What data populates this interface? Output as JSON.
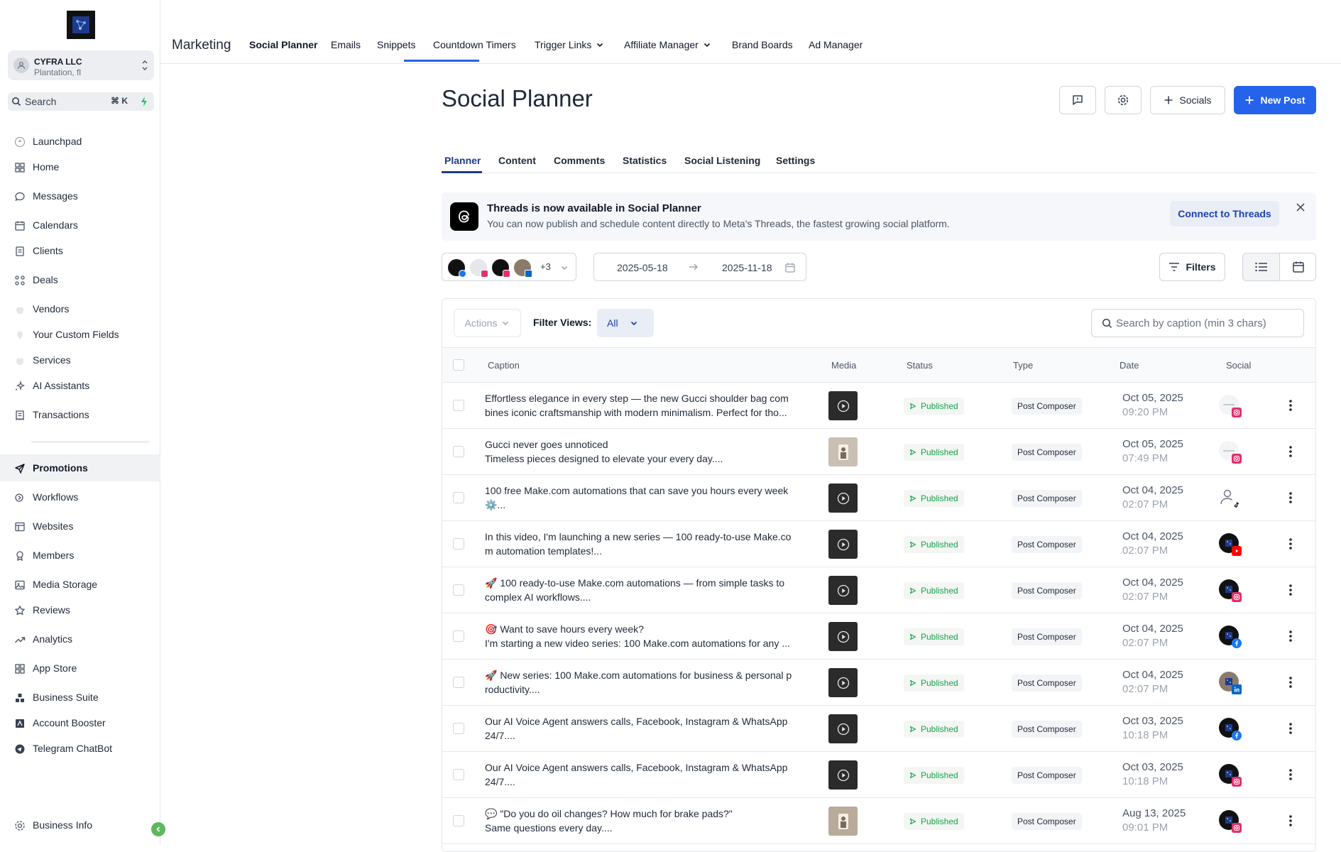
{
  "account": {
    "name": "CYFRA LLC",
    "location": "Plantation, fl"
  },
  "sidebar_search": {
    "label": "Search",
    "shortcut": "⌘ K"
  },
  "sidebar": {
    "items": [
      {
        "label": "Launchpad",
        "icon": "rocket-icon"
      },
      {
        "label": "Home",
        "icon": "grid-icon"
      },
      {
        "label": "Messages",
        "icon": "chat-icon"
      },
      {
        "label": "Calendars",
        "icon": "calendar-icon"
      },
      {
        "label": "Clients",
        "icon": "contacts-icon"
      },
      {
        "label": "Deals",
        "icon": "deals-icon"
      },
      {
        "label": "Vendors",
        "icon": "apple-icon"
      },
      {
        "label": "Your Custom Fields",
        "icon": "pin-icon"
      },
      {
        "label": "Services",
        "icon": "apple-icon"
      },
      {
        "label": "AI Assistants",
        "icon": "sparkle-icon"
      },
      {
        "label": "Transactions",
        "icon": "receipt-icon"
      }
    ],
    "items2": [
      {
        "label": "Promotions",
        "icon": "send-icon"
      },
      {
        "label": "Workflows",
        "icon": "workflow-icon"
      },
      {
        "label": "Websites",
        "icon": "website-icon"
      },
      {
        "label": "Members",
        "icon": "award-icon"
      },
      {
        "label": "Media Storage",
        "icon": "image-icon"
      },
      {
        "label": "Reviews",
        "icon": "star-icon"
      },
      {
        "label": "Analytics",
        "icon": "trend-icon"
      },
      {
        "label": "App Store",
        "icon": "apps-icon"
      },
      {
        "label": "Business Suite",
        "icon": "suite-icon"
      },
      {
        "label": "Account Booster",
        "icon": "booster-icon"
      },
      {
        "label": "Telegram ChatBot",
        "icon": "telegram-icon"
      }
    ],
    "footer": {
      "label": "Business Info",
      "icon": "settings-icon"
    }
  },
  "topbar": {
    "section": "Marketing",
    "nav": [
      "Social Planner",
      "Emails",
      "Snippets",
      "Countdown Timers",
      "Trigger Links",
      "Affiliate Manager",
      "Brand Boards",
      "Ad Manager"
    ]
  },
  "page": {
    "title": "Social Planner",
    "socials_button": "Socials",
    "new_post_button": "New Post",
    "tabs": [
      "Planner",
      "Content",
      "Comments",
      "Statistics",
      "Social Listening",
      "Settings"
    ]
  },
  "banner": {
    "title": "Threads is now available in Social Planner",
    "desc": "You can now publish and schedule content directly to Meta's Threads, the fastest growing social platform.",
    "cta": "Connect to Threads"
  },
  "toolbar": {
    "extra_accounts": "+3",
    "date_from": "2025-05-18",
    "date_to": "2025-11-18",
    "filters": "Filters"
  },
  "table": {
    "actions": "Actions",
    "filter_views_label": "Filter Views:",
    "filter_views_value": "All",
    "search_placeholder": "Search by caption (min 3 chars)",
    "columns": [
      "Caption",
      "Media",
      "Status",
      "Type",
      "Date",
      "Social"
    ],
    "rows": [
      {
        "line1": "Effortless elegance in every step — the new Gucci shoulder bag com",
        "line2": "bines iconic craftsmanship with modern minimalism. Perfect for tho...",
        "media": "video",
        "status": "Published",
        "type": "Post Composer",
        "date": "Oct 05, 2025",
        "time": "09:20 PM",
        "network": "instagram"
      },
      {
        "line1": "Gucci never goes unnoticed",
        "line2": "Timeless pieces designed to elevate your every day....",
        "media": "image",
        "status": "Published",
        "type": "Post Composer",
        "date": "Oct 05, 2025",
        "time": "07:49 PM",
        "network": "instagram"
      },
      {
        "line1": "100 free Make.com automations that can save you hours every week",
        "line2": "⚙️...",
        "media": "video",
        "status": "Published",
        "type": "Post Composer",
        "date": "Oct 04, 2025",
        "time": "02:07 PM",
        "network": "tiktok"
      },
      {
        "line1": "In this video, I'm launching a new series — 100 ready-to-use Make.co",
        "line2": "m automation templates!...",
        "media": "video",
        "status": "Published",
        "type": "Post Composer",
        "date": "Oct 04, 2025",
        "time": "02:07 PM",
        "network": "youtube"
      },
      {
        "line1": "🚀 100 ready-to-use Make.com automations — from simple tasks to",
        "line2": "complex AI workflows....",
        "media": "video",
        "status": "Published",
        "type": "Post Composer",
        "date": "Oct 04, 2025",
        "time": "02:07 PM",
        "network": "instagram"
      },
      {
        "line1": "🎯 Want to save hours every week?",
        "line2": "I'm starting a new video series: 100 Make.com automations for any ...",
        "media": "video",
        "status": "Published",
        "type": "Post Composer",
        "date": "Oct 04, 2025",
        "time": "02:07 PM",
        "network": "facebook"
      },
      {
        "line1": "🚀 New series: 100 Make.com automations for business & personal p",
        "line2": "roductivity....",
        "media": "video",
        "status": "Published",
        "type": "Post Composer",
        "date": "Oct 04, 2025",
        "time": "02:07 PM",
        "network": "linkedin"
      },
      {
        "line1": "Our AI Voice Agent answers calls, Facebook, Instagram & WhatsApp",
        "line2": "24/7....",
        "media": "video",
        "status": "Published",
        "type": "Post Composer",
        "date": "Oct 03, 2025",
        "time": "10:18 PM",
        "network": "facebook"
      },
      {
        "line1": "Our AI Voice Agent answers calls, Facebook, Instagram & WhatsApp",
        "line2": "24/7....",
        "media": "video",
        "status": "Published",
        "type": "Post Composer",
        "date": "Oct 03, 2025",
        "time": "10:18 PM",
        "network": "instagram"
      },
      {
        "line1": "💬 \"Do you do oil changes? How much for brake pads?\"",
        "line2": "Same questions every day....",
        "media": "image",
        "status": "Published",
        "type": "Post Composer",
        "date": "Aug 13, 2025",
        "time": "09:01 PM",
        "network": "instagram"
      }
    ]
  },
  "colors": {
    "primary": "#2563eb",
    "published": "#16a34a",
    "instagram": "#e1306c",
    "facebook": "#1877f2",
    "linkedin": "#0a66c2",
    "youtube": "#ff0000",
    "tiktok": "#000000"
  }
}
